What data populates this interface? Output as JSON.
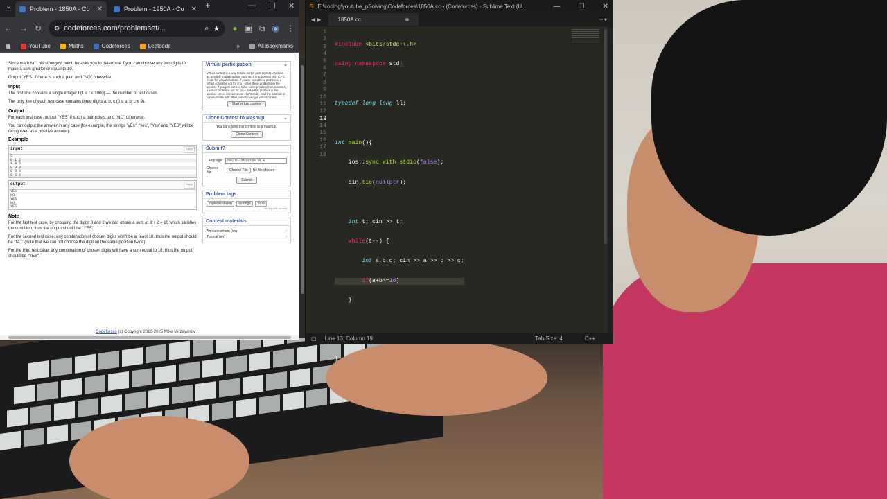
{
  "chrome": {
    "tabs": [
      {
        "title": "Problem - 1850A - Co",
        "active": true
      },
      {
        "title": "Problem - 1950A - Co",
        "active": false
      }
    ],
    "url": "codeforces.com/problemset/...",
    "bookmarks": [
      "YouTube",
      "Maths",
      "Codeforces",
      "Leetcode"
    ],
    "all_bookmarks": "All Bookmarks"
  },
  "problem": {
    "intro": "Since math isn't his strongest point, he asks you to determine if you can choose any two digits to make a sum greater or equal to 10.",
    "output_rule": "Output \"YES\" if there is such a pair, and \"NO\" otherwise.",
    "input_heading": "Input",
    "input_text_1": "The first line contains a single integer t (1 ≤ t ≤ 1000) — the number of test cases.",
    "input_text_2": "The only line of each test case contains three digits a, b, c (0 ≤ a, b, c ≤ 9).",
    "output_heading": "Output",
    "output_text_1": "For each test case, output \"YES\" if such a pair exists, and \"NO\" otherwise.",
    "output_text_2": "You can output the answer in any case (for example, the strings \"yEs\", \"yes\", \"Yes\" and \"YES\" will be recognized as a positive answer).",
    "example_heading": "Example",
    "input_label": "input",
    "output_label": "output",
    "copy_label": "Copy",
    "input_lines": [
      "5",
      "8 1 2",
      "4 4 5",
      "9 9 9",
      "0 0 0",
      "8 5 3"
    ],
    "output_lines": [
      "YES",
      "NO",
      "YES",
      "NO",
      "YES"
    ],
    "note_heading": "Note",
    "note_1": "For the first test case, by choosing the digits 8 and 2 we can obtain a sum of 8 + 2 = 10 which satisfies the condition, thus the output should be \"YES\".",
    "note_2": "For the second test case, any combination of chosen digits won't be at least 10, thus the output should be \"NO\" (note that we can not choose the digit on the same position twice).",
    "note_3": "For the third test case, any combination of chosen digits will have a sum equal to 18, thus the output should be \"YES\".",
    "footer_link": "Codeforces",
    "footer_text": "(c) Copyright 2010-2025 Mike Mirzayanov"
  },
  "sidebar": {
    "virtual_title": "Virtual participation",
    "virtual_text": "Virtual contest is a way to take part in past contest, as close as possible to participation on time. It is supported only ICPC mode for virtual contests. If you've seen these problems, a virtual contest is not for you - solve these problems in the archive. If you just want to solve some problem from a contest, a virtual contest is not for you - solve this problem in the archive. Never use someone else's code, read the tutorials or communicate with other person during a virtual contest.",
    "virtual_button": "Start virtual contest",
    "clone_title": "Clone Contest to Mashup",
    "clone_text": "You can clone this contest to a mashup.",
    "clone_button": "Clone Contest",
    "submit_title": "Submit?",
    "language_label": "Language:",
    "language_value": "GNU G++23 14.2 (64 bit, w",
    "file_label": "Choose file:",
    "choose_button": "Choose File",
    "no_file": "No file chosen",
    "submit_button": "Submit",
    "tags_title": "Problem tags",
    "tags": [
      "implementation",
      "sortings",
      "*800"
    ],
    "no_tag_edit": "No tag edit access",
    "materials_title": "Contest materials",
    "materials": [
      "Announcement (en)",
      "Tutorial (en)"
    ]
  },
  "sublime": {
    "title": "E:\\coding\\youtube_pSolving\\Codeforces\\1850A.cc • (Codeforces) - Sublime Text (U...",
    "tab": "1850A.cc",
    "status_position": "Line 13, Column 19",
    "status_tab": "Tab Size: 4",
    "status_syntax": "C++",
    "line_numbers": [
      "1",
      "2",
      "3",
      "4",
      "5",
      "6",
      "7",
      "8",
      "9",
      "10",
      "11",
      "12",
      "13",
      "14",
      "15",
      "16",
      "17",
      "18"
    ],
    "current_line": 13
  }
}
